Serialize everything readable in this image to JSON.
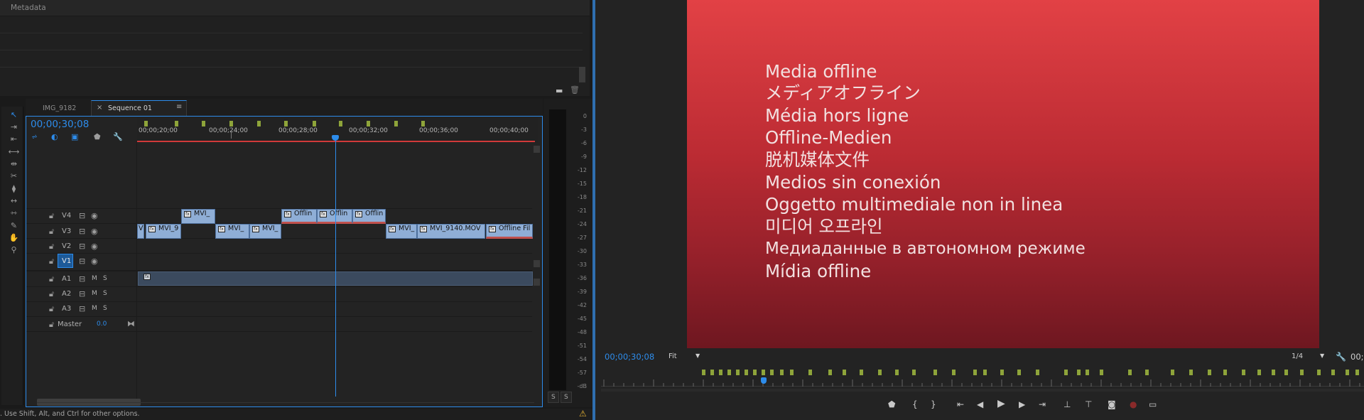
{
  "metadata_panel": {
    "title": "Metadata"
  },
  "timeline": {
    "tabs": [
      {
        "label": "IMG_9182"
      },
      {
        "label": "Sequence 01"
      }
    ],
    "timecode": "00;00;30;08",
    "ruler_labels": [
      "00;00;20;00",
      "00;00;24;00",
      "00;00;28;00",
      "00;00;32;00",
      "00;00;36;00",
      "00;00;40;00"
    ],
    "tracks": [
      {
        "name": "V4"
      },
      {
        "name": "V3"
      },
      {
        "name": "V2"
      },
      {
        "name": "V1"
      },
      {
        "name": "A1",
        "m": "M",
        "s": "S"
      },
      {
        "name": "A2",
        "m": "M",
        "s": "S"
      },
      {
        "name": "A3",
        "m": "M",
        "s": "S"
      }
    ],
    "master": {
      "label": "Master",
      "value": "0.0"
    },
    "clips": {
      "v4_1": "MVI_",
      "v4_2": "Offlin",
      "v4_3": "Offlin",
      "v4_4": "Offlin",
      "v3_0": "V",
      "v3_1": "MVI_9",
      "v3_2": "MVI_",
      "v3_3": "MVI_",
      "v3_4": "MVI_",
      "v3_5": "MVI_9140.MOV",
      "v3_6": "Offline Fil"
    }
  },
  "audio_meter": {
    "scale": [
      "0",
      "-3",
      "-6",
      "-9",
      "-12",
      "-15",
      "-18",
      "-21",
      "-24",
      "-27",
      "-30",
      "-33",
      "-36",
      "-39",
      "-42",
      "-45",
      "-48",
      "-51",
      "-54",
      "-57",
      "-dB"
    ],
    "solo": [
      "S",
      "S"
    ]
  },
  "program_monitor": {
    "offline_lines": [
      "Media offline",
      "メディアオフライン",
      "Média hors ligne",
      "Offline-Medien",
      "脱机媒体文件",
      "Medios sin conexión",
      "Oggetto multimediale non in linea",
      "미디어 오프라인",
      "Медиаданные в автономном режиме",
      "Mídia offline"
    ],
    "timecode": "00;00;30;08",
    "zoom": "Fit",
    "resolution": "1/4",
    "end_timecode": "00;"
  },
  "status_bar": {
    "text": ". Use Shift, Alt, and Ctrl for other options."
  },
  "colors": {
    "accent": "#2d8ceb",
    "playhead": "#2d8ceb",
    "clip_video": "#8faed6",
    "offline_red": "#c0504d",
    "workarea": "#d03a3a"
  }
}
